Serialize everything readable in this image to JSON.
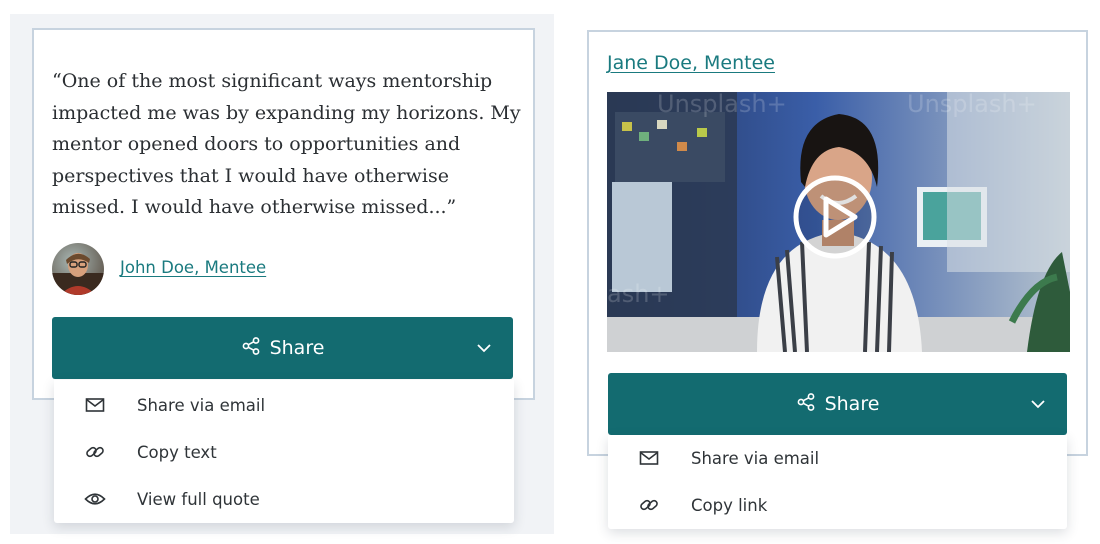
{
  "colors": {
    "accent": "#136b70",
    "link": "#1a7a7f",
    "card_border": "#c7d3df",
    "page_bg": "#f1f3f6"
  },
  "quote_card": {
    "quote": "“One of the most significant ways mentorship impacted me was by expanding my horizons. My mentor opened doors to opportunities and perspectives that I would have otherwise missed. I would have otherwise missed...”",
    "author_link": "John Doe, Mentee",
    "avatar_icon": "person-photo",
    "share_button": {
      "label": "Share",
      "icon": "share-icon",
      "chevron": "chevron-down-icon"
    },
    "share_menu": [
      {
        "label": "Share via email",
        "icon": "mail-icon"
      },
      {
        "label": "Copy text",
        "icon": "link-icon"
      },
      {
        "label": "View full quote",
        "icon": "eye-icon"
      }
    ]
  },
  "video_card": {
    "author_link": "Jane Doe, Mentee",
    "video": {
      "play_icon": "play-icon",
      "watermark": "Unsplash+"
    },
    "share_button": {
      "label": "Share",
      "icon": "share-icon",
      "chevron": "chevron-down-icon"
    },
    "share_menu": [
      {
        "label": "Share via email",
        "icon": "mail-icon"
      },
      {
        "label": "Copy link",
        "icon": "link-icon"
      }
    ]
  }
}
